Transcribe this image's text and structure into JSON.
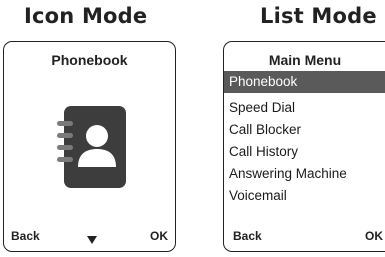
{
  "headings": {
    "icon_mode": "Icon Mode",
    "list_mode": "List Mode"
  },
  "icon_mode_screen": {
    "title": "Phonebook",
    "icon": "phonebook-icon",
    "left_softkey": "Back",
    "right_softkey": "OK",
    "nav_indicator": "down-arrow-icon"
  },
  "list_mode_screen": {
    "title": "Main Menu",
    "items": [
      {
        "label": "Phonebook",
        "selected": true
      },
      {
        "label": "Speed Dial",
        "selected": false
      },
      {
        "label": "Call Blocker",
        "selected": false
      },
      {
        "label": "Call History",
        "selected": false
      },
      {
        "label": "Answering Machine",
        "selected": false
      },
      {
        "label": "Voicemail",
        "selected": false
      }
    ],
    "left_softkey": "Back",
    "right_softkey": "OK"
  },
  "colors": {
    "selection_highlight": "#5a5a5a",
    "icon_fill": "#3d3d3d",
    "border": "#222222"
  }
}
